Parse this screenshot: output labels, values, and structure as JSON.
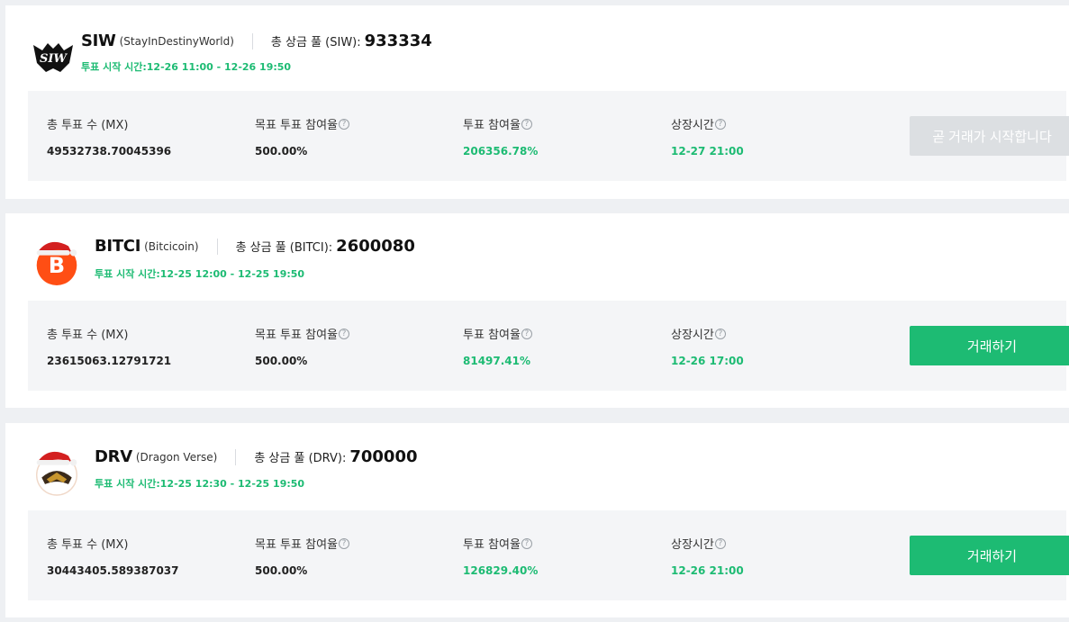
{
  "labels": {
    "total_votes": "총 투표 수 (MX)",
    "target_rate": "목표 투표 참여율",
    "vote_rate": "투표 참여율",
    "listing_time": "상장시간",
    "pool_prefix": "총 상금 풀"
  },
  "colors": {
    "accent_green": "#1dbb73",
    "disabled_button": "#dcdfe2"
  },
  "projects": [
    {
      "symbol": "SIW",
      "name": "(StayInDestinyWorld)",
      "pool_label": "총 상금 풀 (SIW):",
      "pool_value": "933334",
      "vote_time": "투표 시작 시간:12-26 11:00 - 12-26 19:50",
      "total_votes": "49532738.70045396",
      "target_rate": "500.00%",
      "vote_rate": "206356.78%",
      "listing_time": "12-27 21:00",
      "button_label": "곧 거래가 시작합니다",
      "logo_icon": "siw-logo",
      "logo_text": "SIW"
    },
    {
      "symbol": "BITCI",
      "name": "(Bitcicoin)",
      "pool_label": "총 상금 풀 (BITCI):",
      "pool_value": "2600080",
      "vote_time": "투표 시작 시간:12-25 12:00 - 12-25 19:50",
      "total_votes": "23615063.12791721",
      "target_rate": "500.00%",
      "vote_rate": "81497.41%",
      "listing_time": "12-26 17:00",
      "button_label": "거래하기",
      "logo_icon": "bitci-logo-santa-hat"
    },
    {
      "symbol": "DRV",
      "name": "(Dragon Verse)",
      "pool_label": "총 상금 풀 (DRV):",
      "pool_value": "700000",
      "vote_time": "투표 시작 시간:12-25 12:30 - 12-25 19:50",
      "total_votes": "30443405.589387037",
      "target_rate": "500.00%",
      "vote_rate": "126829.40%",
      "listing_time": "12-26 21:00",
      "button_label": "거래하기",
      "logo_icon": "drv-logo-santa-hat"
    }
  ]
}
